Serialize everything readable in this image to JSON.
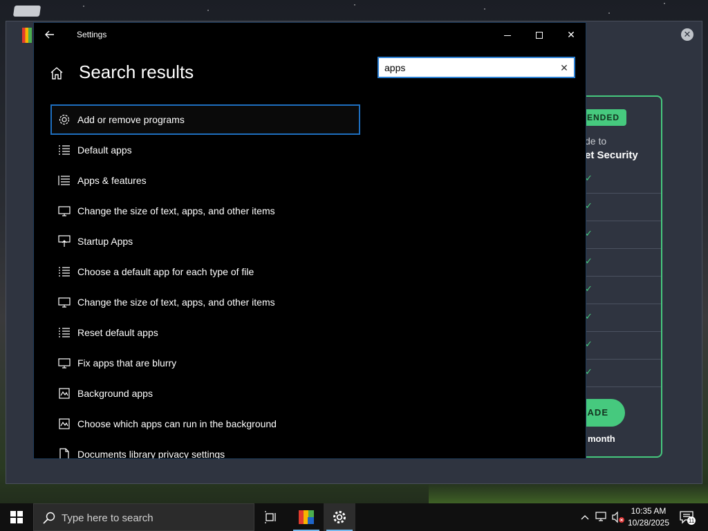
{
  "background_app": {
    "badge": "MENDED",
    "line1": "de to",
    "line2": "et Security",
    "upgrade_label": "RADE",
    "price": "month",
    "close_glyph": "✕",
    "accent_color": "#46c97e"
  },
  "settings": {
    "window_title": "Settings",
    "page_title": "Search results",
    "back_icon": "arrow-left-icon",
    "close_glyph": "✕",
    "search": {
      "value": "apps",
      "clear_glyph": "✕"
    },
    "results": [
      {
        "label": "Add or remove programs",
        "icon": "gear-icon",
        "selected": true
      },
      {
        "label": "Default apps",
        "icon": "list-icon"
      },
      {
        "label": "Apps & features",
        "icon": "list-icon"
      },
      {
        "label": "Change the size of text, apps, and other items",
        "icon": "monitor-icon"
      },
      {
        "label": "Startup Apps",
        "icon": "startup-icon"
      },
      {
        "label": "Choose a default app for each type of file",
        "icon": "list-icon"
      },
      {
        "label": "Change the size of text, apps, and other items",
        "icon": "monitor-icon"
      },
      {
        "label": "Reset default apps",
        "icon": "list-icon"
      },
      {
        "label": "Fix apps that are blurry",
        "icon": "monitor-icon"
      },
      {
        "label": "Background apps",
        "icon": "activity-icon"
      },
      {
        "label": "Choose which apps can run in the background",
        "icon": "activity-icon"
      },
      {
        "label": "Documents library privacy settings",
        "icon": "document-icon"
      }
    ]
  },
  "taskbar": {
    "search_placeholder": "Type here to search",
    "time": "10:35 AM",
    "date": "10/28/2025",
    "notification_count": "11",
    "active_accent": "#76b9ed"
  }
}
